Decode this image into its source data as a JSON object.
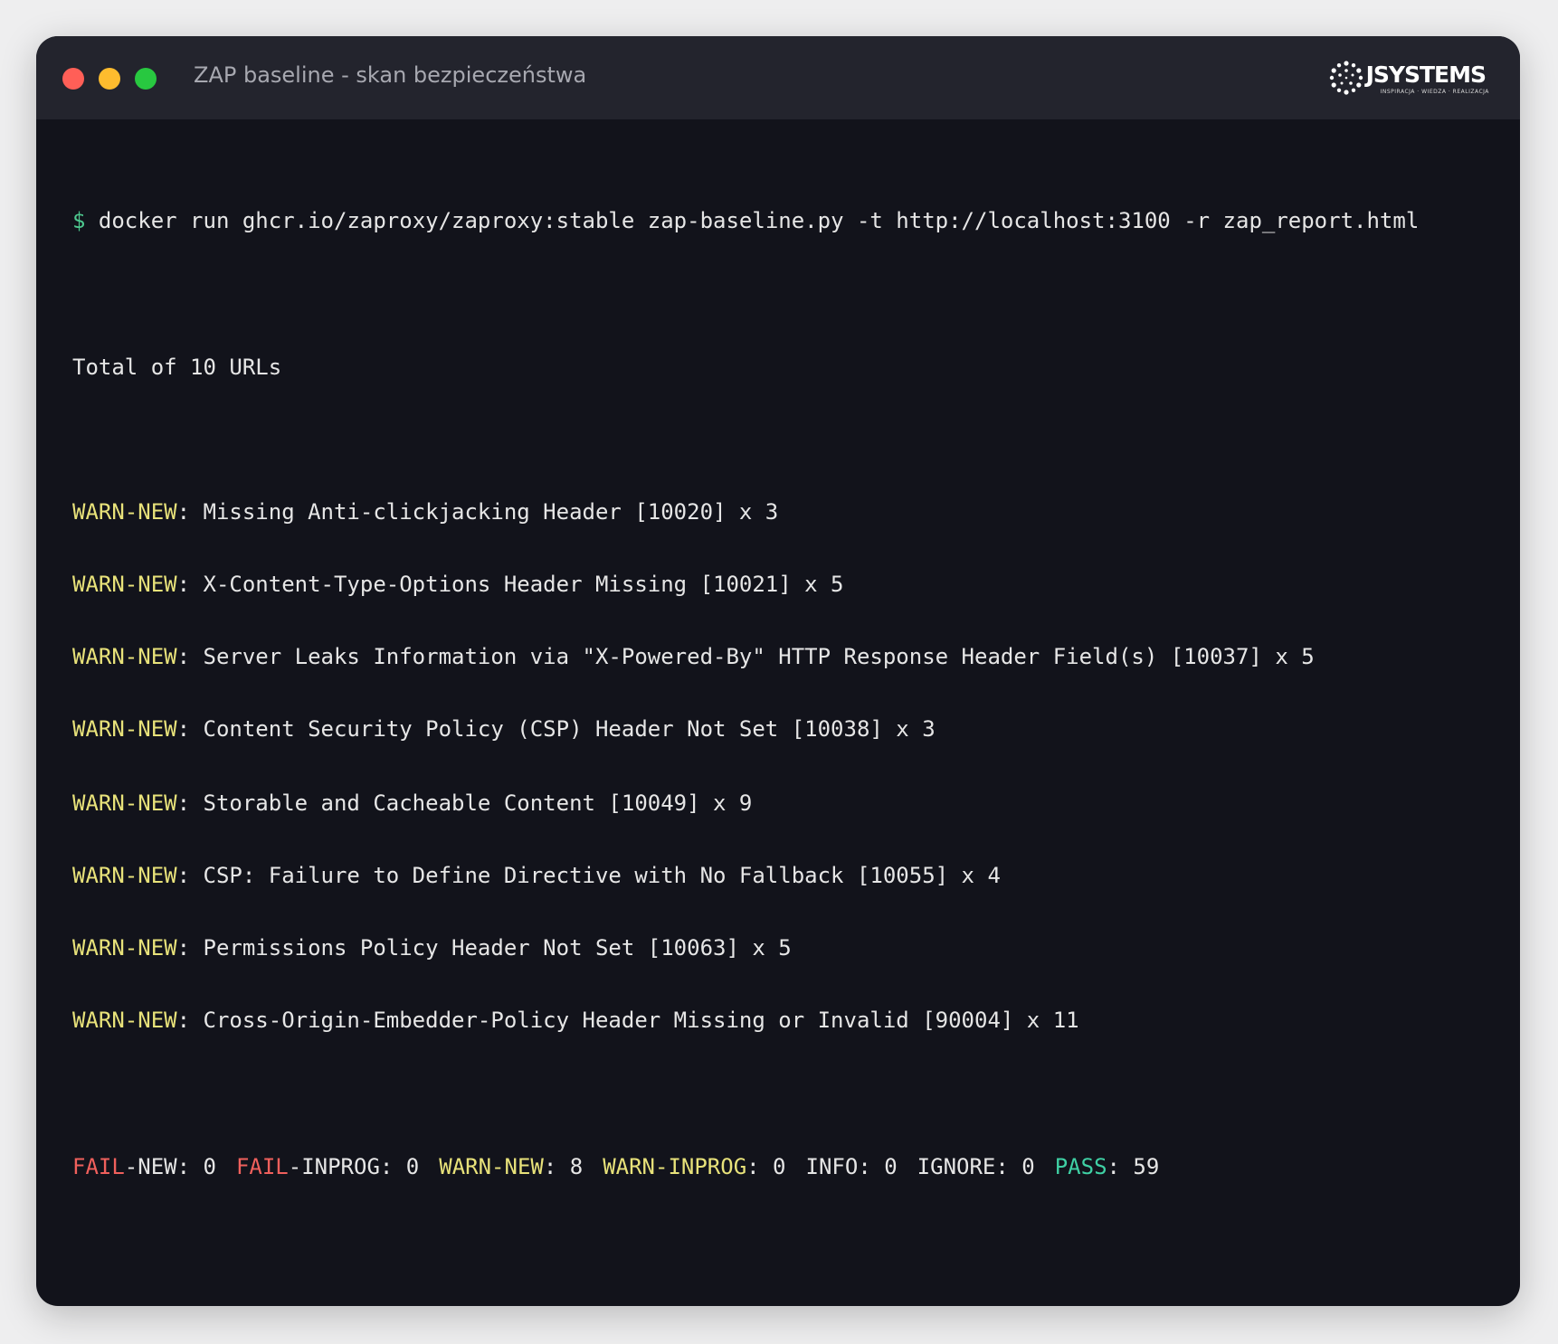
{
  "window": {
    "title": "ZAP baseline - skan bezpieczeństwa",
    "logo_text": "JSYSTEMS",
    "logo_tagline": "INSPIRACJA · WIEDZA · REALIZACJA",
    "logo_icon": "dotted-circle-icon",
    "traffic_lights": [
      "#ff5f57",
      "#febc2e",
      "#28c840"
    ]
  },
  "terminal": {
    "prompt_symbol": "$",
    "command": "docker run ghcr.io/zaproxy/zaproxy:stable zap-baseline.py -t http://localhost:3100 -r zap_report.html",
    "total_line": "Total of 10 URLs",
    "warnings": [
      {
        "tag": "WARN-NEW",
        "text": ": Missing Anti-clickjacking Header [10020] x 3"
      },
      {
        "tag": "WARN-NEW",
        "text": ": X-Content-Type-Options Header Missing [10021] x 5"
      },
      {
        "tag": "WARN-NEW",
        "text": ": Server Leaks Information via \"X-Powered-By\" HTTP Response Header Field(s) [10037] x 5"
      },
      {
        "tag": "WARN-NEW",
        "text": ": Content Security Policy (CSP) Header Not Set [10038] x 3"
      },
      {
        "tag": "WARN-NEW",
        "text": ": Storable and Cacheable Content [10049] x 9"
      },
      {
        "tag": "WARN-NEW",
        "text": ": CSP: Failure to Define Directive with No Fallback [10055] x 4"
      },
      {
        "tag": "WARN-NEW",
        "text": ": Permissions Policy Header Not Set [10063] x 5"
      },
      {
        "tag": "WARN-NEW",
        "text": ": Cross-Origin-Embedder-Policy Header Missing or Invalid [90004] x 11"
      }
    ],
    "summary": {
      "fail_new_tag": "FAIL",
      "fail_new_rest": "-NEW: 0",
      "fail_inprog_tag": "FAIL",
      "fail_inprog_rest": "-INPROG: 0",
      "warn_new_tag": "WARN-NEW",
      "warn_new_rest": ": 8",
      "warn_inprog_tag": "WARN-INPROG",
      "warn_inprog_rest": ": 0",
      "info": "INFO: 0",
      "ignore": "IGNORE: 0",
      "pass_tag": "PASS",
      "pass_rest": ": 59"
    },
    "colors": {
      "background": "#12131b",
      "text": "#e6e6e6",
      "prompt": "#4ec98f",
      "warn": "#e8e27a",
      "fail": "#f0605c",
      "pass": "#3fd0a4"
    }
  }
}
